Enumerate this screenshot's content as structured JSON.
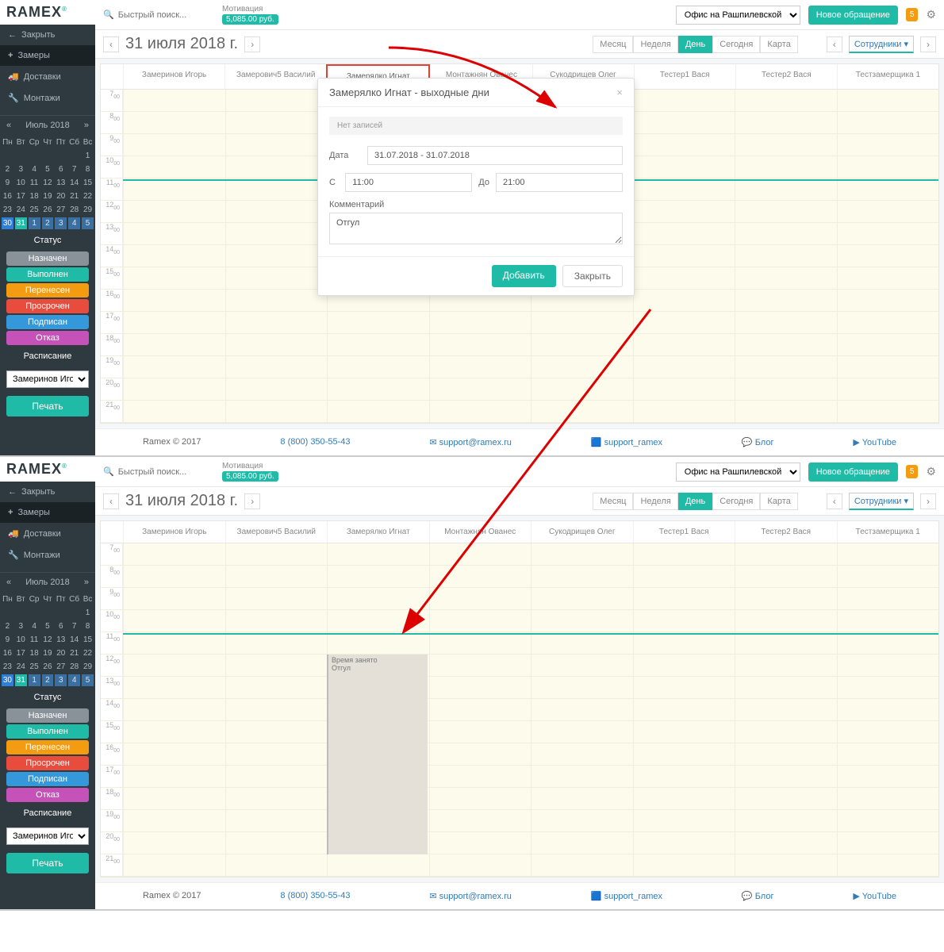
{
  "logo": "RAMEX",
  "search_placeholder": "Быстрый поиск...",
  "motivation": {
    "label": "Мотивация",
    "value": "5,085.00 руб."
  },
  "office": "Офис на Рашпилевской",
  "new_request": "Новое обращение",
  "bell_count": "5",
  "side": {
    "close": "Закрыть",
    "measure": "Замеры",
    "delivery": "Доставки",
    "install": "Монтажи"
  },
  "cal": {
    "month": "Июль 2018",
    "dow": [
      "Пн",
      "Вт",
      "Ср",
      "Чт",
      "Пт",
      "Сб",
      "Вс"
    ],
    "weeks": [
      [
        "",
        "",
        "",
        "",
        "",
        "",
        "1"
      ],
      [
        "2",
        "3",
        "4",
        "5",
        "6",
        "7",
        "8"
      ],
      [
        "9",
        "10",
        "11",
        "12",
        "13",
        "14",
        "15"
      ],
      [
        "16",
        "17",
        "18",
        "19",
        "20",
        "21",
        "22"
      ],
      [
        "23",
        "24",
        "25",
        "26",
        "27",
        "28",
        "29"
      ],
      [
        "30",
        "31",
        "1",
        "2",
        "3",
        "4",
        "5"
      ]
    ]
  },
  "status": {
    "hdr": "Статус",
    "items": [
      "Назначен",
      "Выполнен",
      "Перенесен",
      "Просрочен",
      "Подписан",
      "Отказ"
    ]
  },
  "schedule_hdr": "Расписание",
  "employee_sel": "Замеринов Игор",
  "print": "Печать",
  "date_title": "31 июля 2018 г.",
  "views": [
    "Месяц",
    "Неделя",
    "День",
    "Сегодня",
    "Карта"
  ],
  "emp_dd": "Сотрудники",
  "employees": [
    "Замеринов Игорь",
    "Замерович5 Василий",
    "Замерялко Игнат",
    "Монтажнян Ованес",
    "Сукодрищев Олег",
    "Тестер1 Вася",
    "Тестер2 Вася",
    "Тестзамерщика 1"
  ],
  "hours": [
    "7",
    "8",
    "9",
    "10",
    "11",
    "12",
    "13",
    "14",
    "15",
    "16",
    "17",
    "18",
    "19",
    "20",
    "21"
  ],
  "modal": {
    "title": "Замерялко Игнат - выходные дни",
    "empty": "Нет записей",
    "date_lbl": "Дата",
    "date_val": "31.07.2018 - 31.07.2018",
    "from_lbl": "С",
    "from_val": "11:00",
    "to_lbl": "До",
    "to_val": "21:00",
    "comment_lbl": "Комментарий",
    "comment_val": "Отгул",
    "add": "Добавить",
    "close": "Закрыть"
  },
  "block": {
    "line1": "Время занято",
    "line2": "Отгул"
  },
  "footer": {
    "copy": "Ramex © 2017",
    "phone": "8 (800) 350-55-43",
    "email": "support@ramex.ru",
    "skype": "support_ramex",
    "blog": "Блог",
    "yt": "YouTube"
  }
}
